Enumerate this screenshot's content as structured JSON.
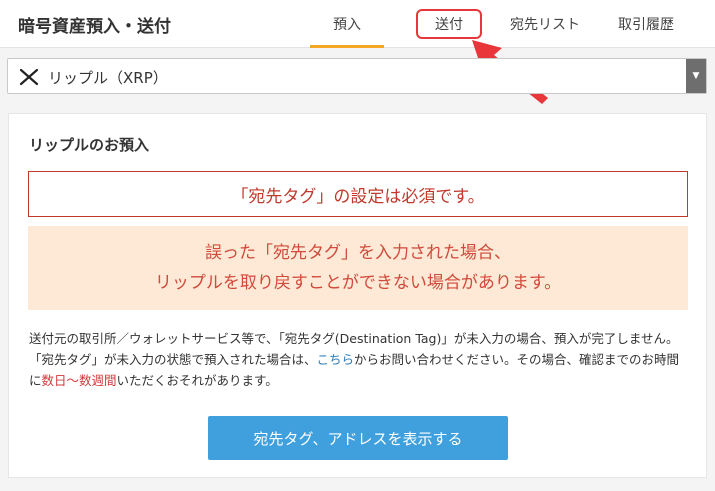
{
  "header": {
    "title": "暗号資産預入・送付",
    "tabs": {
      "deposit": "預入",
      "send": "送付",
      "addresses": "宛先リスト",
      "history": "取引履歴"
    }
  },
  "currency_select": {
    "selected": "リップル（XRP）"
  },
  "card": {
    "title": "リップルのお預入",
    "tag_required": "「宛先タグ」の設定は必須です。",
    "warning_line1": "誤った「宛先タグ」を入力された場合、",
    "warning_line2": "リップルを取り戻すことができない場合があります。",
    "desc_part1": "送付元の取引所／ウォレットサービス等で、「宛先タグ(Destination Tag)」が未入力の場合、預入が完了しません。「宛先タグ」が未入力の状態で預入された場合は、",
    "desc_link": "こちら",
    "desc_part2": "からお問い合わせください。その場合、確認までのお時間に",
    "desc_red": "数日～数週間",
    "desc_part3": "いただくおそれがあります。",
    "button": "宛先タグ、アドレスを表示する"
  },
  "colors": {
    "accent": "#f5a623",
    "highlight": "#e8363a",
    "button": "#3fa0dd",
    "warning_bg": "#fde9d6",
    "warning_text": "#d14a3b"
  }
}
